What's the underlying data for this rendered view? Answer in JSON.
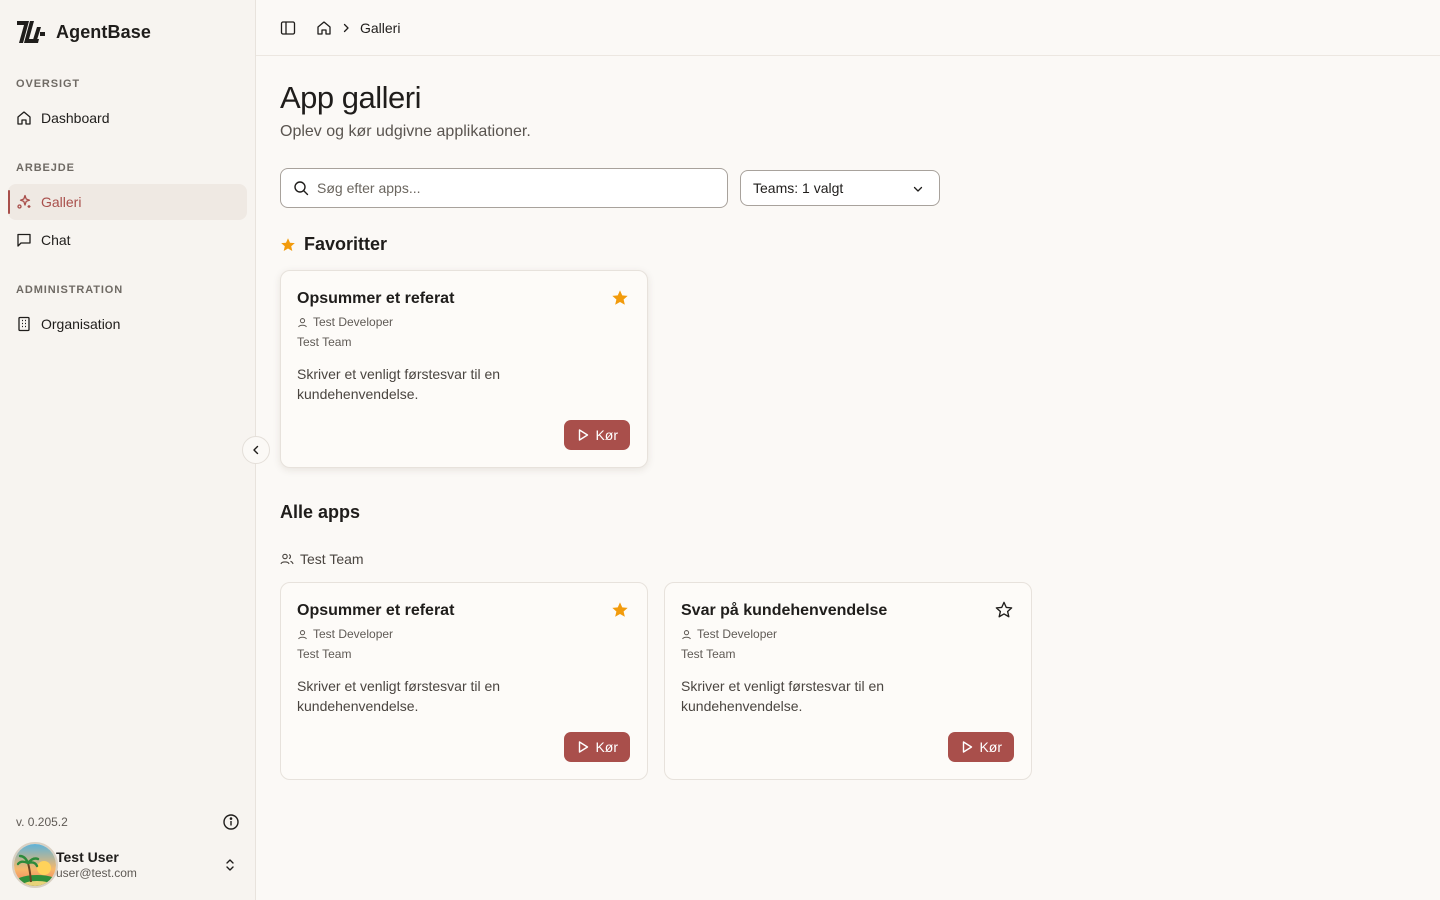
{
  "app": {
    "name": "AgentBase"
  },
  "sidebar": {
    "sections": [
      {
        "label": "OVERSIGT",
        "items": [
          {
            "label": "Dashboard",
            "icon": "home-icon"
          }
        ]
      },
      {
        "label": "ARBEJDE",
        "items": [
          {
            "label": "Galleri",
            "icon": "sparkles-icon",
            "active": true
          },
          {
            "label": "Chat",
            "icon": "chat-icon"
          }
        ]
      },
      {
        "label": "ADMINISTRATION",
        "items": [
          {
            "label": "Organisation",
            "icon": "building-icon"
          }
        ]
      }
    ],
    "version": "v. 0.205.2",
    "user": {
      "name": "Test User",
      "email": "user@test.com"
    }
  },
  "breadcrumb": {
    "current": "Galleri"
  },
  "page": {
    "title": "App galleri",
    "subtitle": "Oplev og kør udgivne applikationer."
  },
  "search": {
    "placeholder": "Søg efter apps...",
    "value": ""
  },
  "team_filter": {
    "label": "Teams: 1 valgt"
  },
  "favorites": {
    "heading": "Favoritter",
    "cards": [
      {
        "title": "Opsummer et referat",
        "author": "Test Developer",
        "team": "Test Team",
        "description": "Skriver et venligt førstesvar til en kundehenvendelse.",
        "favorited": true,
        "run_label": "Kør"
      }
    ]
  },
  "all_apps": {
    "heading": "Alle apps",
    "group": "Test Team",
    "cards": [
      {
        "title": "Opsummer et referat",
        "author": "Test Developer",
        "team": "Test Team",
        "description": "Skriver et venligt førstesvar til en kundehenvendelse.",
        "favorited": true,
        "run_label": "Kør"
      },
      {
        "title": "Svar på kundehenvendelse",
        "author": "Test Developer",
        "team": "Test Team",
        "description": "Skriver et venligt førstesvar til en kundehenvendelse.",
        "favorited": false,
        "run_label": "Kør"
      }
    ]
  },
  "colors": {
    "accent": "#a94f4b",
    "star": "#f29b0c",
    "background": "#fbf9f6",
    "sidebar": "#f7f4f0"
  }
}
